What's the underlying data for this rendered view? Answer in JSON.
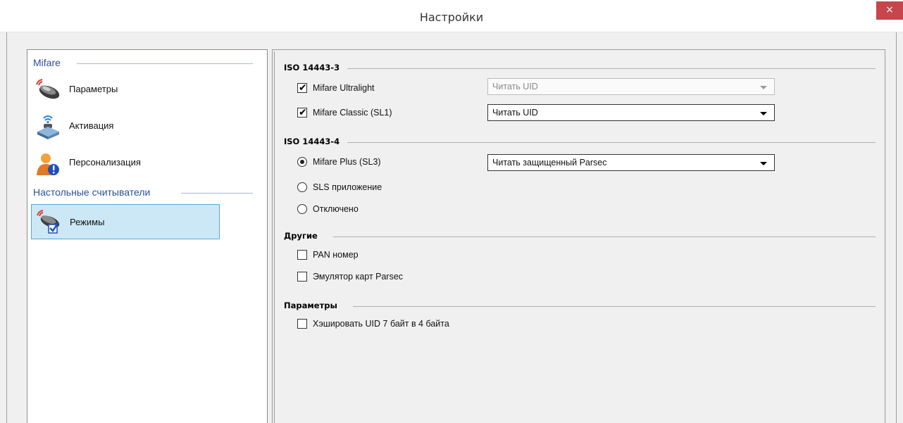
{
  "window": {
    "title": "Настройки",
    "close_glyph": "×"
  },
  "sidebar": {
    "groups": [
      {
        "label": "Mifare",
        "items": [
          {
            "label": "Параметры",
            "icon": "card-reader-icon"
          },
          {
            "label": "Активация",
            "icon": "activation-icon"
          },
          {
            "label": "Персонализация",
            "icon": "user-info-icon"
          }
        ]
      },
      {
        "label": "Настольные считыватели",
        "items": [
          {
            "label": "Режимы",
            "icon": "modes-icon",
            "selected": true
          }
        ]
      }
    ]
  },
  "main": {
    "iso3": {
      "title": "ISO 14443-3",
      "ultralight": {
        "label": "Mifare Ultralight",
        "checked": true,
        "mode": "Читать UID",
        "mode_enabled": false
      },
      "classic": {
        "label": "Mifare Classic (SL1)",
        "checked": true,
        "mode": "Читать UID",
        "mode_enabled": true
      }
    },
    "iso4": {
      "title": "ISO 14443-4",
      "options": [
        {
          "label": "Mifare Plus (SL3)",
          "selected": true
        },
        {
          "label": "SLS приложение",
          "selected": false
        },
        {
          "label": "Отключено",
          "selected": false
        }
      ],
      "plus_mode": "Читать защищенный Parsec"
    },
    "other": {
      "title": "Другие",
      "pan": {
        "label": "PAN номер",
        "checked": false
      },
      "emulator": {
        "label": "Эмулятор карт Parsec",
        "checked": false
      }
    },
    "params": {
      "title": "Параметры",
      "hash": {
        "label": "Хэшировать UID 7 байт в 4 байта",
        "checked": false
      }
    }
  },
  "colors": {
    "close_button": "#c7464b",
    "group_label": "#2b4f9a",
    "selection_bg": "#cce8f6",
    "selection_border": "#5aa6d6"
  }
}
